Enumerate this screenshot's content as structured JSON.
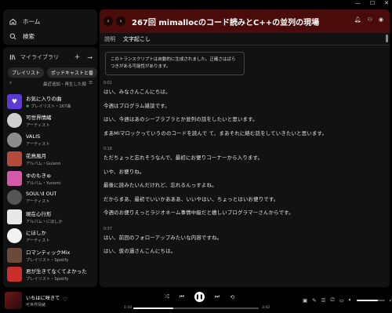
{
  "window": {
    "minimize": "—",
    "maximize": "☐",
    "close": "✕"
  },
  "nav": {
    "home": "ホーム",
    "search": "検索"
  },
  "library": {
    "title": "マイライブラリ",
    "chips": [
      "プレイリスト",
      "ポッドキャストと番"
    ],
    "sort_label": "最近追加・再生した順",
    "items": [
      {
        "title": "お気に入りの曲",
        "subtitle": "プレイリスト・167曲",
        "pinned": true,
        "color": "#5b3ad6",
        "round": false
      },
      {
        "title": "可世界情緒",
        "subtitle": "アーティスト",
        "pinned": false,
        "color": "#cfcfcf",
        "round": true
      },
      {
        "title": "VALIS",
        "subtitle": "アーティスト",
        "pinned": false,
        "color": "#8c8c8c",
        "round": true
      },
      {
        "title": "花鳥風月",
        "subtitle": "アルバム・Guiano",
        "pinned": false,
        "color": "#b54a3a",
        "round": false
      },
      {
        "title": "ゆのもきゅ",
        "subtitle": "アルバム・Yunomi",
        "pinned": false,
        "color": "#d25aa8",
        "round": false
      },
      {
        "title": "SOUL'd OUT",
        "subtitle": "アーティスト",
        "pinned": false,
        "color": "#555555",
        "round": true
      },
      {
        "title": "現在心行形",
        "subtitle": "アルバム・にほしか",
        "pinned": false,
        "color": "#e8e8e8",
        "round": false
      },
      {
        "title": "にほしか",
        "subtitle": "アーティスト",
        "pinned": false,
        "color": "#f2f2f2",
        "round": true
      },
      {
        "title": "ロマンティックMix",
        "subtitle": "プレイリスト・Spotify",
        "pinned": false,
        "color": "#6a4a3a",
        "round": false
      },
      {
        "title": "君が生きてなくてよかった",
        "subtitle": "プレイリスト・Spotify",
        "pinned": false,
        "color": "#c9302c",
        "round": false
      }
    ]
  },
  "episode": {
    "title": "267回 mimallocのコード読みとC++の並列の現場",
    "tabs": [
      "説明",
      "文字起こし"
    ],
    "notice": "このトランスクリプトは自動的に生成されました。正確さはばらつきがある可能性があります。",
    "transcript": [
      {
        "ts": "0:01",
        "lines": [
          "はい、みなさんこんにちは。",
          "今週はプログラム雑談です。",
          "はい、今週はあのシープラプラとか並列の話をしたいと思います。",
          "まあMIマロックっていうののコードを読んで て、まあそれに絡む話をしていきたいと思います。"
        ]
      },
      {
        "ts": "0:18",
        "lines": [
          "ただちょっと忘れそうなんで、最初にお便りコーナーから入ります。",
          "いや、お便りね。",
          "最後に読みたいんだけれど、忘れるんっすよね。",
          "だからまあ、最初でいいかあああ、いいやはい、ちょっとはいお便りです。",
          "今週のお便りえっとラジオネーム事情中級だと嬉しいプログラマーさんからです。"
        ]
      },
      {
        "ts": "0:37",
        "lines": [
          "はい、前回のフォローアップみたいな内容ですね。",
          "はい、仮の過さんこんにちは。"
        ]
      }
    ]
  },
  "player": {
    "title": "いちはに咲きて",
    "artist": "可世界情緒",
    "elapsed": "1:10",
    "total": "3:42",
    "progress": 0.32,
    "volume": 0.75
  }
}
